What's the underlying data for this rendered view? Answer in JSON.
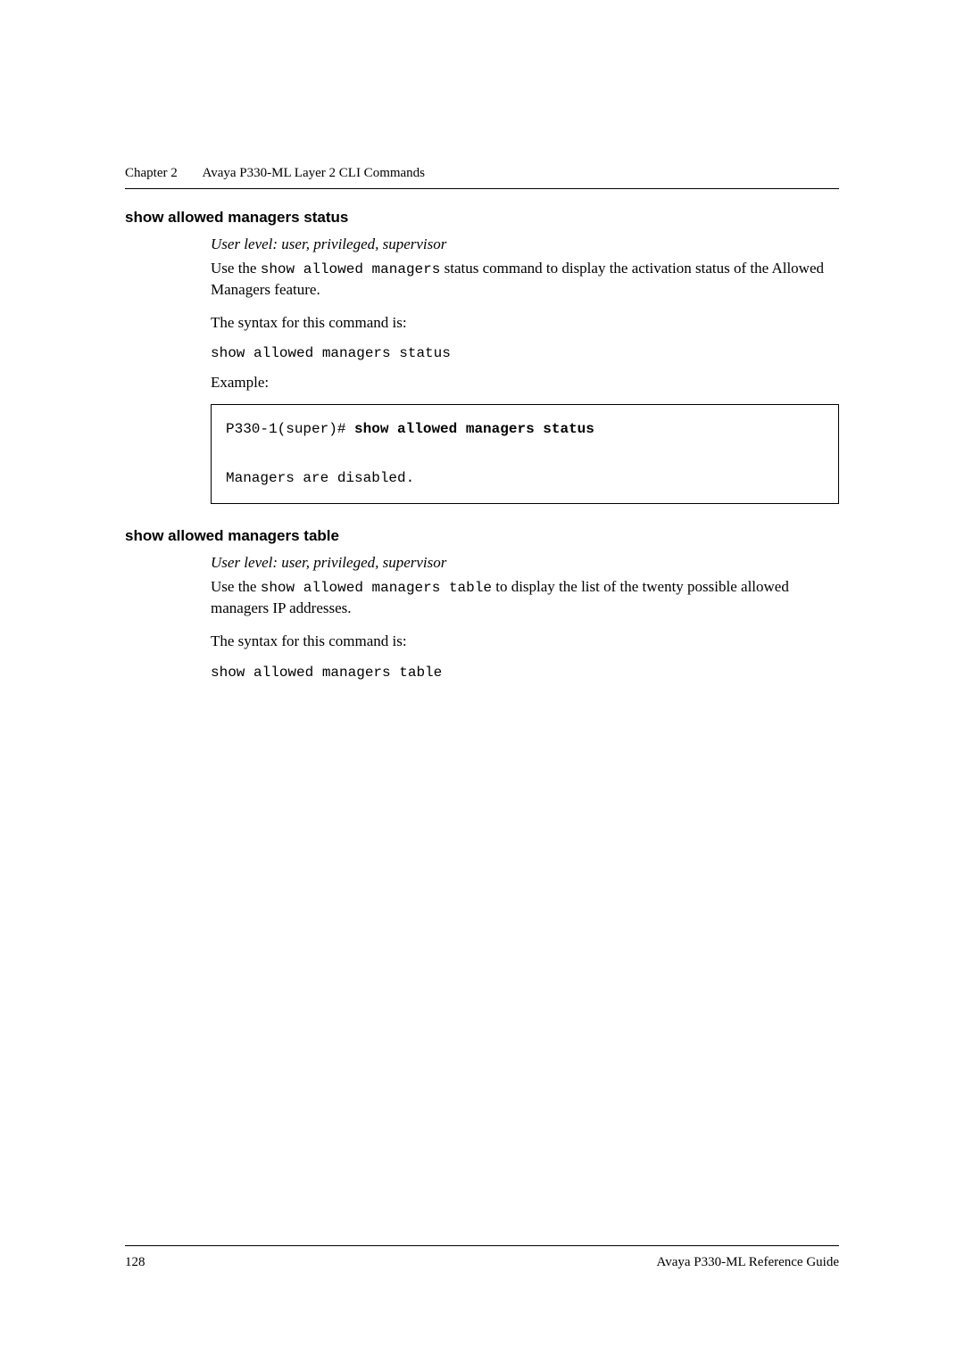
{
  "header": {
    "chapter": "Chapter 2",
    "title": "Avaya P330-ML Layer 2 CLI Commands"
  },
  "section1": {
    "heading": "show allowed managers status",
    "user_level": "User level: user, privileged, supervisor",
    "desc_pre": "Use the ",
    "desc_cmd": "show allowed managers",
    "desc_post": " status command to display the activation status of the Allowed Managers feature.",
    "syntax_intro": "The syntax for this command is:",
    "syntax_cmd": "show allowed managers status",
    "example_label": "Example:",
    "example_prompt": "P330-1(super)# ",
    "example_bold": "show allowed managers status",
    "example_output": "Managers are disabled."
  },
  "section2": {
    "heading": "show allowed managers table",
    "user_level": "User level: user, privileged, supervisor",
    "desc_pre": "Use the ",
    "desc_cmd": "show allowed managers table",
    "desc_post": " to display the list of the twenty possible allowed managers IP addresses.",
    "syntax_intro": "The syntax for this command is:",
    "syntax_cmd": "show allowed managers table"
  },
  "footer": {
    "page_number": "128",
    "guide": "Avaya P330-ML Reference Guide"
  }
}
